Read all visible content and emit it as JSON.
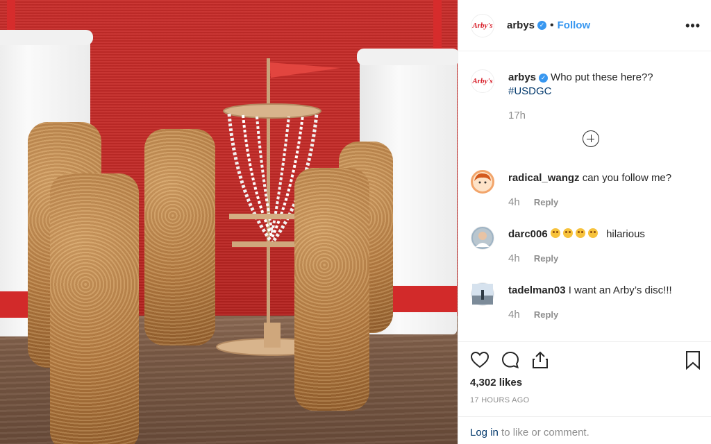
{
  "post": {
    "account": "arbys",
    "logo_text": "Arby's",
    "follow_label": "Follow",
    "more_label": "•••",
    "caption_user": "arbys",
    "caption_text": "Who put these here??",
    "caption_tag": "#USDGC",
    "caption_time": "17h"
  },
  "comments": [
    {
      "user": "radical_wangz",
      "text": "can you follow me?",
      "time": "4h",
      "reply": "Reply"
    },
    {
      "user": "darc006",
      "text": "hilarious",
      "emoji_count": 4,
      "time": "4h",
      "reply": "Reply"
    },
    {
      "user": "tadelman03",
      "text": "I want an Arby’s disc!!!",
      "time": "4h",
      "reply": "Reply"
    }
  ],
  "actions": {
    "likes": "4,302 likes",
    "timestamp": "17 HOURS AGO",
    "icons": [
      "heart-icon",
      "comment-icon",
      "share-icon",
      "bookmark-icon"
    ]
  },
  "footer": {
    "login_label": "Log in",
    "rest_text": "to like or comment."
  },
  "colors": {
    "accent": "#3897f0",
    "brand_red": "#d71e28",
    "link": "#00376b",
    "muted": "#8e8e8e"
  }
}
